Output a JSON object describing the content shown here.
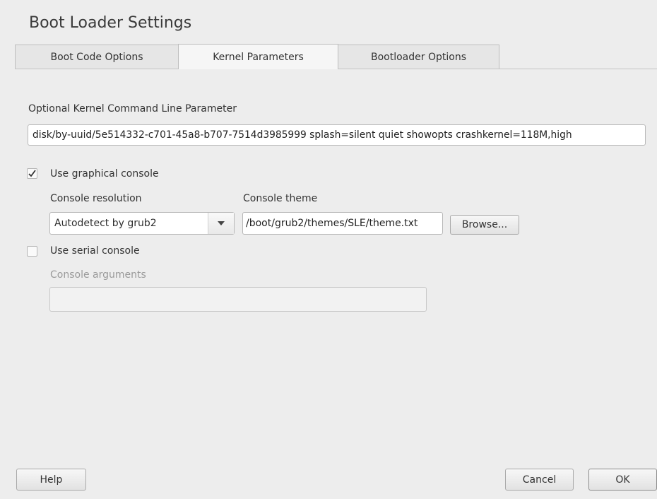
{
  "dialog": {
    "title": "Boot Loader Settings"
  },
  "tabs": [
    {
      "label": "Boot Code Options",
      "active": false
    },
    {
      "label": "Kernel Parameters",
      "active": true
    },
    {
      "label": "Bootloader Options",
      "active": false
    }
  ],
  "kernel": {
    "label": "Optional Kernel Command Line Parameter",
    "value": "disk/by-uuid/5e514332-c701-45a8-b707-7514d3985999 splash=silent quiet showopts crashkernel=118M,high"
  },
  "graphical_console": {
    "checkbox_label": "Use graphical console",
    "checked": true,
    "resolution_label": "Console resolution",
    "resolution_value": "Autodetect by grub2",
    "theme_label": "Console theme",
    "theme_value": "/boot/grub2/themes/SLE/theme.txt",
    "browse_label": "Browse..."
  },
  "serial_console": {
    "checkbox_label": "Use serial console",
    "checked": false,
    "arguments_label": "Console arguments",
    "arguments_value": ""
  },
  "footer": {
    "help_label": "Help",
    "cancel_label": "Cancel",
    "ok_label": "OK"
  },
  "icons": {
    "check": "check-icon",
    "dropdown": "chevron-down-icon"
  }
}
